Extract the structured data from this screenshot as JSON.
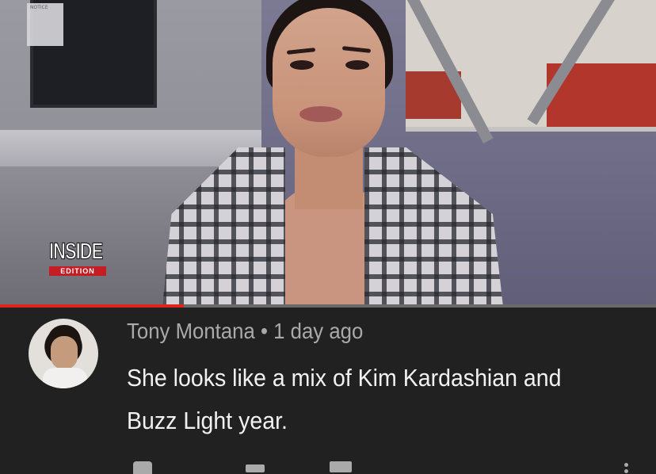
{
  "video": {
    "notice_sign": "NOTICE",
    "watermark": {
      "line1": "INSIDE",
      "line2": "EDITION"
    },
    "progress_fraction": 0.28
  },
  "comment": {
    "author": "Tony Montana",
    "separator": "•",
    "time": "1 day ago",
    "text": "She looks like a mix of Kim Kardashian and Buzz Light year.",
    "like_count": "",
    "reply_count": ""
  },
  "colors": {
    "background": "#212121",
    "meta_text": "#aaaaaa",
    "comment_text": "#f1f1f1",
    "progress": "#e0231b",
    "brand_red": "#c41e24"
  },
  "icons": {
    "like": "thumbs-up-icon",
    "dislike": "thumbs-down-icon",
    "reply": "reply-icon",
    "menu": "more-vertical-icon"
  }
}
